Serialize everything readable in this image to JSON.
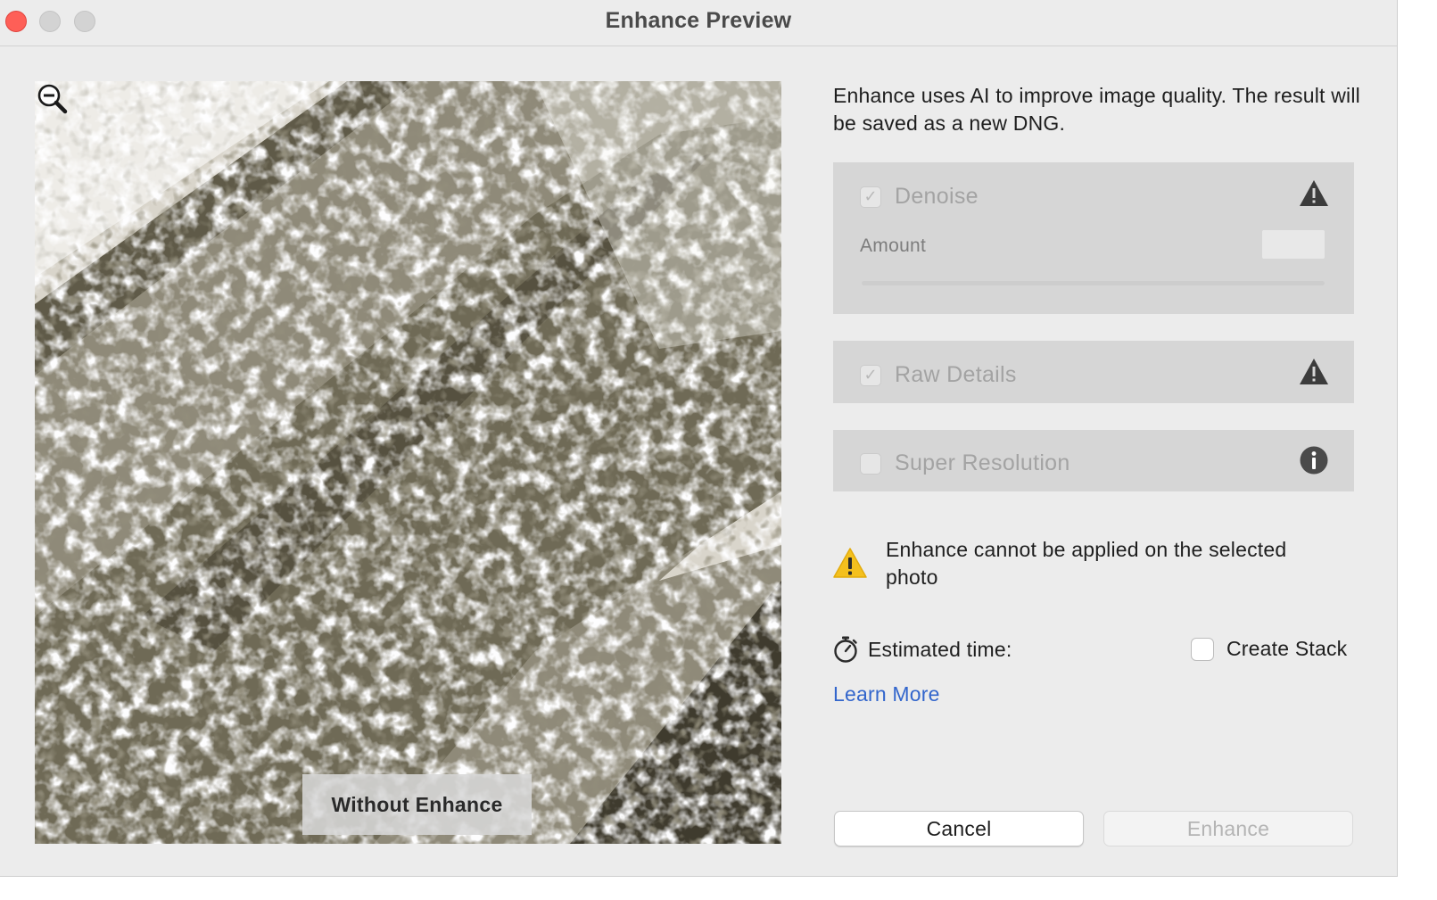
{
  "window": {
    "title": "Enhance Preview"
  },
  "preview": {
    "compare_label": "Without Enhance",
    "zoom_icon": "zoom-out-icon"
  },
  "panel": {
    "intro": "Enhance uses AI to improve image quality. The result will be saved as a new DNG.",
    "denoise": {
      "label": "Denoise",
      "checked": true,
      "disabled": true,
      "icon": "warning-icon",
      "amount_label": "Amount",
      "amount_value": ""
    },
    "raw_details": {
      "label": "Raw Details",
      "checked": true,
      "disabled": true,
      "icon": "warning-icon"
    },
    "super_resolution": {
      "label": "Super Resolution",
      "checked": false,
      "disabled": true,
      "icon": "info-icon"
    },
    "warning_message": "Enhance cannot be applied on the selected photo",
    "estimated_time_label": "Estimated time:",
    "create_stack": {
      "label": "Create Stack",
      "checked": false
    },
    "learn_more": "Learn More"
  },
  "buttons": {
    "cancel": "Cancel",
    "enhance": "Enhance"
  },
  "colors": {
    "window_bg": "#ececec",
    "section_bg": "#d6d6d6",
    "link": "#3366cc",
    "warning": "#f4c01e",
    "close_button": "#fe5f57"
  }
}
